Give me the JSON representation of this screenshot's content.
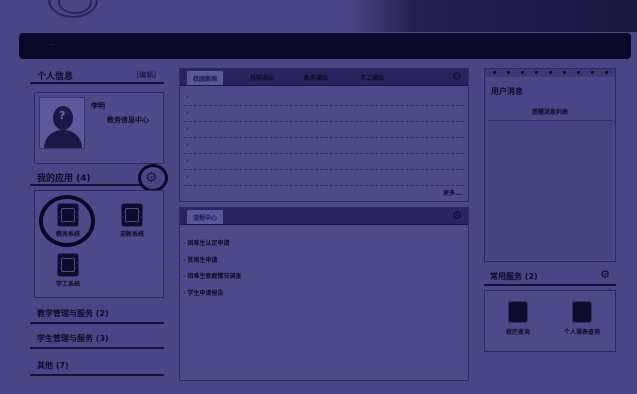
{
  "nav": {
    "text": "··"
  },
  "profile": {
    "section_title": "个人信息",
    "edit_link": "[编辑]",
    "name": "李明",
    "dept": "教务信息中心",
    "avatar_glyph": "?"
  },
  "my_apps": {
    "title": "我的应用",
    "count": "(4)",
    "items": [
      {
        "label": "教务系统",
        "icon": "document-icon"
      },
      {
        "label": "迎新系统",
        "icon": "pen-icon"
      },
      {
        "label": "学工系统",
        "icon": "folder-icon"
      }
    ]
  },
  "categories": [
    {
      "title": "教学管理与服务",
      "count": "(2)"
    },
    {
      "title": "学生管理与服务",
      "count": "(3)"
    },
    {
      "title": "其他",
      "count": "(7)"
    }
  ],
  "news": {
    "tabs": [
      "校园新闻",
      "校务通知",
      "教务通知",
      "学工通知"
    ],
    "active_tab": 0,
    "rows": [
      "›",
      "›",
      "›",
      "›",
      "›",
      "›"
    ],
    "more": "更多..."
  },
  "process": {
    "tab": "流程中心",
    "items": [
      "· 困难生认定申请",
      "· 贫困生申请",
      "· 困难生家庭情况调查",
      "· 学生申请报告"
    ]
  },
  "messages": {
    "title": "用户消息",
    "subtitle": "提醒消息列表"
  },
  "services": {
    "title": "常用服务",
    "count": "(2)",
    "items": [
      {
        "label": "校历查询",
        "icon": "calendar-icon"
      },
      {
        "label": "个人课表查询",
        "icon": "schedule-icon"
      }
    ]
  },
  "colors": {
    "background": "#4a4585",
    "navbar": "#0a0826",
    "panel": "#4e4a8a"
  }
}
